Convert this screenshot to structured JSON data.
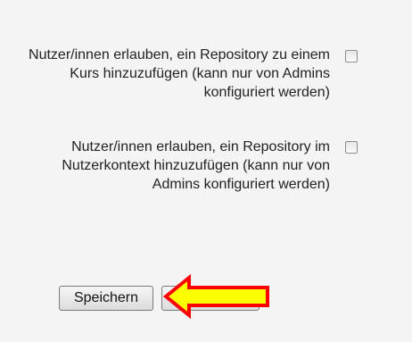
{
  "settings": {
    "options": [
      {
        "label": "Nutzer/innen erlauben, ein Repository zu einem Kurs hinzuzufügen (kann nur von Admins konfiguriert werden)",
        "checked": false
      },
      {
        "label": "Nutzer/innen erlauben, ein Repository im Nutzerkontext hinzuzufügen (kann nur von Admins konfiguriert werden)",
        "checked": false
      }
    ]
  },
  "actions": {
    "save_label": "Speichern",
    "cancel_label": ""
  },
  "annotation": {
    "arrow_fill": "#ffff00",
    "arrow_stroke": "#ff0000",
    "arrow_icon": "left-arrow-icon"
  }
}
